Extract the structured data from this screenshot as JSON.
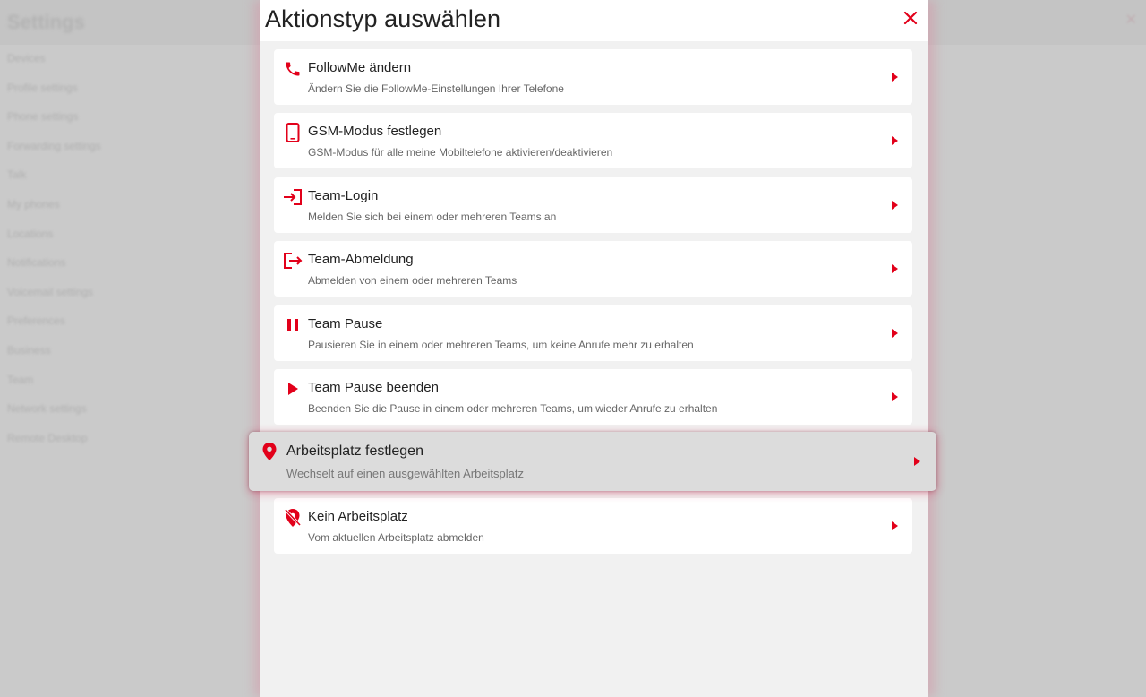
{
  "background": {
    "title": "Settings",
    "menu": [
      "Devices",
      "Profile settings",
      "Phone settings",
      "Forwarding settings",
      "Talk",
      "My phones",
      "Locations",
      "Notifications",
      "Voicemail settings",
      "Preferences",
      "Business",
      "Team",
      "Network settings",
      "Remote Desktop"
    ]
  },
  "modal": {
    "title": "Aktionstyp auswählen",
    "close_icon": "close-icon",
    "actions": [
      {
        "icon": "phone-icon",
        "title": "FollowMe ändern",
        "description": "Ändern Sie die FollowMe-Einstellungen Ihrer Telefone"
      },
      {
        "icon": "mobile-phone-icon",
        "title": "GSM-Modus festlegen",
        "description": "GSM-Modus für alle meine Mobiltelefone aktivieren/deaktivieren"
      },
      {
        "icon": "login-icon",
        "title": "Team-Login",
        "description": "Melden Sie sich bei einem oder mehreren Teams an"
      },
      {
        "icon": "logout-icon",
        "title": "Team-Abmeldung",
        "description": "Abmelden von einem oder mehreren Teams"
      },
      {
        "icon": "pause-icon",
        "title": "Team Pause",
        "description": "Pausieren Sie in einem oder mehreren Teams, um keine Anrufe mehr zu erhalten"
      },
      {
        "icon": "play-icon",
        "title": "Team Pause beenden",
        "description": "Beenden Sie die Pause in einem oder mehreren Teams, um wieder Anrufe zu erhalten"
      },
      {
        "icon": "location-pin-icon",
        "title": "Arbeitsplatz festlegen",
        "description": "Wechselt auf einen ausgewählten Arbeitsplatz",
        "highlighted": true
      },
      {
        "icon": "location-off-icon",
        "title": "Kein Arbeitsplatz",
        "description": "Vom aktuellen Arbeitsplatz abmelden"
      }
    ]
  },
  "colors": {
    "accent": "#e2001a",
    "card_background": "#ffffff",
    "highlight_background": "#dcdcdc",
    "modal_background": "#f1f1f1"
  }
}
